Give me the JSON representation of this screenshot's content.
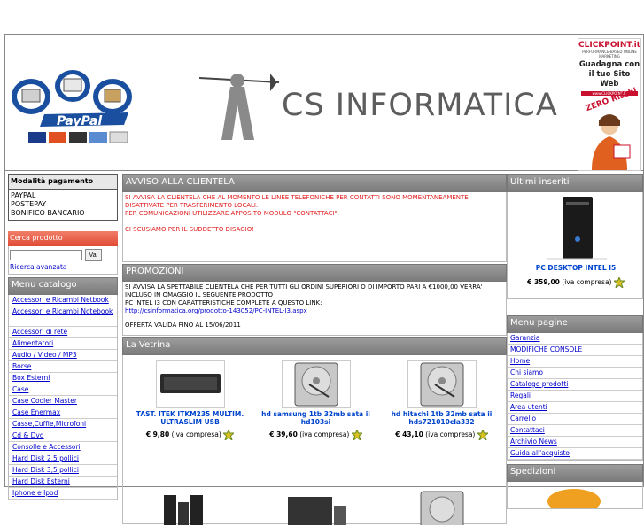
{
  "header": {
    "site_name": "CS INFORMATICA",
    "paypal_label": "PayPal",
    "card_labels": [
      "VISA",
      "MasterCard",
      "AMEX",
      "BANK",
      "eCHECK"
    ]
  },
  "ad": {
    "brand": "CLICKPOINT.it",
    "tagline": "PERFORMANCE-BASED ONLINE MARKETING",
    "headline": "Guadagna con il tuo Sito Web",
    "url": "www.CLICKPOINT.IT",
    "badge": "ZERO Rischi"
  },
  "payment": {
    "title": "Modalità pagamento",
    "methods": [
      "PAYPAL",
      "POSTEPAY",
      "BONIFICO BANCARIO"
    ]
  },
  "search": {
    "title": "Cerca prodotto",
    "button": "Vai",
    "advanced": "Ricerca avanzata"
  },
  "catalog": {
    "title": "Menu catalogo",
    "items": [
      "Accessori e Ricambi Netbook",
      "Accessori e Ricambi Notebook",
      "Accessori di rete",
      "Alimentatori",
      "Audio / Video / MP3",
      "Borse",
      "Box Esterni",
      "Case",
      "Case Cooler Master",
      "Case Enermax",
      "Casse,Cuffie,Microfoni",
      "Cd & Dvd",
      "Consolle e Accessori",
      "Hard Disk 2,5 pollici",
      "Hard Disk 3,5 pollici",
      "Hard Disk Esterni",
      "Iphone e Ipod"
    ]
  },
  "avviso": {
    "title": "AVVISO ALLA CLIENTELA",
    "lines": [
      "SI AVVISA LA CLIENTELA CHE AL MOMENTO LE LINEE TELEFONICHE PER CONTATTI SONO MOMENTANEAMENTE DISATTIVATE PER TRASFERIMENTO LOCALI.",
      "PER COMUNICAZIONI UTILIZZARE APPOSITO MODULO \"CONTATTACI\".",
      "",
      "CI SCUSIAMO PER IL SUDDETTO DISAGIO!"
    ]
  },
  "promozioni": {
    "title": "PROMOZIONI",
    "text1": "SI AVVISA LA SPETTABILE CLIENTELA CHE PER TUTTI GLI ORDINI SUPERIORI O DI IMPORTO PARI A €1000,00 VERRA' INCLUSO IN OMAGGIO IL SEGUENTE PRODOTTO",
    "text2": "PC INTEL I3 CON CARATTERISTICHE COMPLETE A QUESTO LINK:",
    "link": "http://csinformatica.org/prodotto-143052/PC-INTEL-I3.aspx",
    "validity": "OFFERTA VALIDA FINO AL 15/06/2011"
  },
  "vetrina": {
    "title": "La Vetrina",
    "products": [
      {
        "name": "TAST. ITEK ITKM235 MULTIM. ULTRASLIM USB",
        "price": "€ 9,80",
        "tax": "(iva compresa)"
      },
      {
        "name": "hd samsung 1tb 32mb sata ii hd103si",
        "price": "€ 39,60",
        "tax": "(iva compresa)"
      },
      {
        "name": "hd hitachi 1tb 32mb sata ii hds721010cla332",
        "price": "€ 43,10",
        "tax": "(iva compresa)"
      }
    ]
  },
  "ultimi": {
    "title": "Ultimi inseriti",
    "product": {
      "name": "PC DESKTOP INTEL I5",
      "price": "€ 359,00",
      "tax": "(iva compresa)"
    }
  },
  "menu_pagine": {
    "title": "Menu pagine",
    "items": [
      "Garanzia",
      "MODIFICHE CONSOLE",
      "Home",
      "Chi siamo",
      "Catalogo prodotti",
      "Regali",
      "Area utenti",
      "Carrello",
      "Contattaci",
      "Archivio News",
      "Guida all'acquisto"
    ]
  },
  "spedizioni": {
    "title": "Spedizioni"
  },
  "colors": {
    "accent_red": "#e8503a",
    "header_grey": "#8a8a8a",
    "link_blue": "#0000cc",
    "product_blue": "#0044cc",
    "alert_red": "#e02020"
  }
}
